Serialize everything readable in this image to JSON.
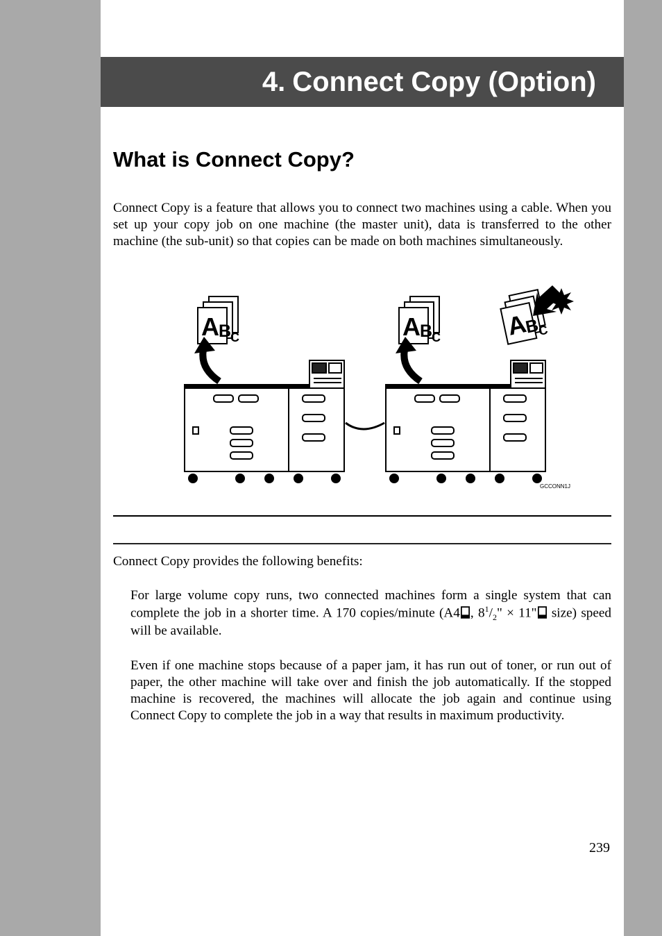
{
  "chapter": {
    "number": "4.",
    "title": "Connect Copy (Option)"
  },
  "section": {
    "title": "What is Connect Copy?"
  },
  "intro": "Connect Copy is a feature that allows you to connect two machines using a cable. When you set up your copy job on one machine (the master unit), data is transferred to the other machine (the sub-unit) so that copies can be made on both machines simultaneously.",
  "benefits_lead": "Connect Copy provides the following benefits:",
  "benefit1": {
    "prefix": "For large volume copy runs, two connected machines form a single system that can complete the job in a shorter time. A 170 copies/minute (A4",
    "comma": ", 8",
    "frac_num": "1",
    "frac_slash": "/",
    "frac_den": "2",
    "times": "\" × 11\"",
    "suffix": "size) speed will be available."
  },
  "benefit2": "Even if one machine stops because of a paper jam, it has run out of toner, or run out of paper, the other machine will take over and finish the job automatically. If the stopped machine is recovered, the machines will allocate the job again and continue using Connect Copy to complete the job in a way that results in maximum productivity.",
  "fig_code": "GCCONN1J",
  "page": "239"
}
